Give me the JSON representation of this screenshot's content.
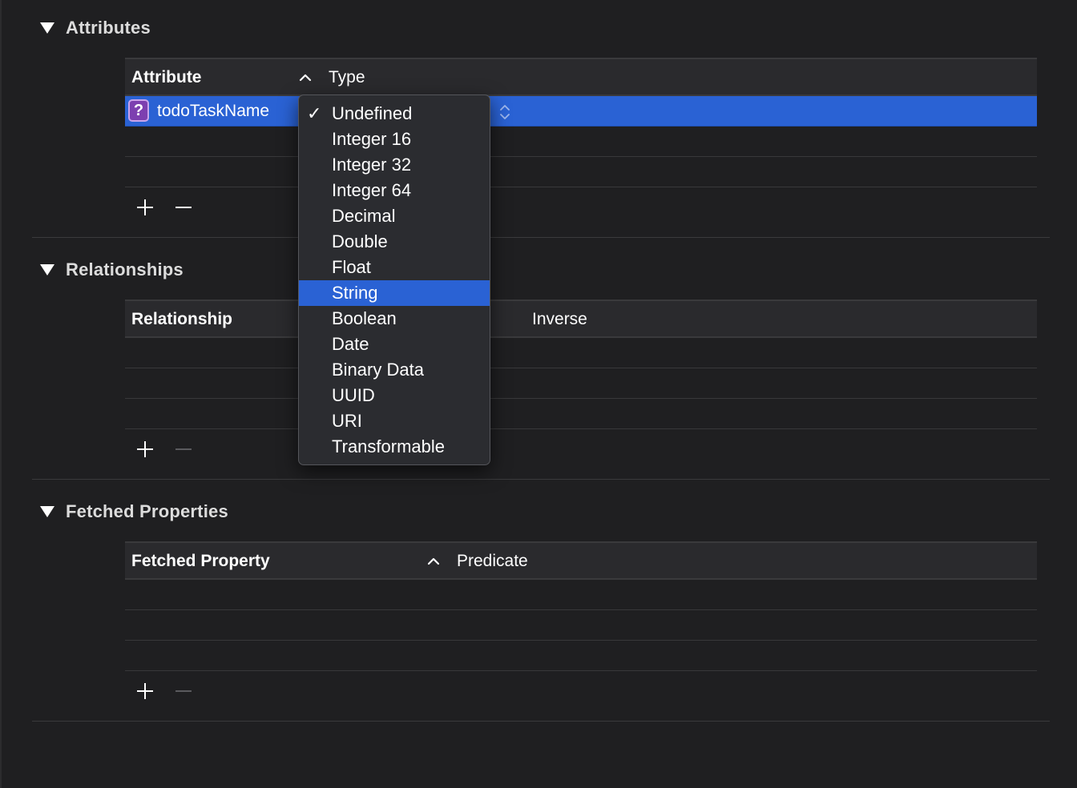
{
  "sections": {
    "attributes": {
      "title": "Attributes",
      "columns": {
        "name": "Attribute",
        "type": "Type"
      },
      "rows": [
        {
          "name": "todoTaskName",
          "type_badge": "?"
        }
      ]
    },
    "relationships": {
      "title": "Relationships",
      "columns": {
        "name": "Relationship",
        "inverse": "Inverse"
      }
    },
    "fetched": {
      "title": "Fetched Properties",
      "columns": {
        "name": "Fetched Property",
        "predicate": "Predicate"
      }
    }
  },
  "type_menu": {
    "checked_item": "Undefined",
    "highlighted_item": "String",
    "items": [
      "Undefined",
      "Integer 16",
      "Integer 32",
      "Integer 64",
      "Decimal",
      "Double",
      "Float",
      "String",
      "Boolean",
      "Date",
      "Binary Data",
      "UUID",
      "URI",
      "Transformable"
    ]
  },
  "icons": {
    "check": "✓",
    "sort_ascending": "chevron-up-icon",
    "stepper": "up-down-stepper-icon",
    "add": "plus-icon",
    "remove": "minus-icon"
  },
  "colors": {
    "selection": "#2a62d4",
    "background": "#1f1f21",
    "menu_bg": "#2b2c30",
    "badge": "#7d3fb0"
  }
}
